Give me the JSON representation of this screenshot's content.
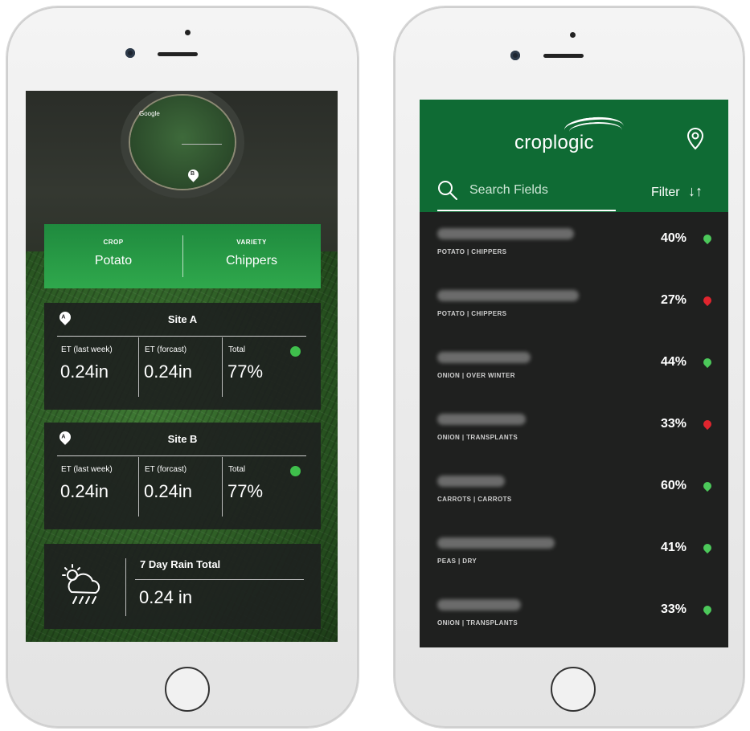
{
  "left_screen": {
    "map": {
      "google_label": "Google",
      "pin_label": "B"
    },
    "crop": {
      "crop_header": "CROP",
      "crop_value": "Potato",
      "variety_header": "VARIETY",
      "variety_value": "Chippers"
    },
    "sites": [
      {
        "pin": "A",
        "name": "Site A",
        "metrics": [
          {
            "label": "ET (last week)",
            "value": "0.24in"
          },
          {
            "label": "ET (forcast)",
            "value": "0.24in"
          },
          {
            "label": "Total",
            "value": "77%"
          }
        ],
        "status_color": "#3fbf4c"
      },
      {
        "pin": "A",
        "name": "Site B",
        "metrics": [
          {
            "label": "ET (last week)",
            "value": "0.24in"
          },
          {
            "label": "ET (forcast)",
            "value": "0.24in"
          },
          {
            "label": "Total",
            "value": "77%"
          }
        ],
        "status_color": "#3fbf4c"
      }
    ],
    "rain": {
      "title": "7 Day Rain Total",
      "value": "0.24 in",
      "icon": "cloud-rain-sun-icon"
    }
  },
  "right_screen": {
    "brand": "croplogic",
    "search": {
      "placeholder": "Search Fields"
    },
    "filter_label": "Filter",
    "colors": {
      "header": "#0f6b34",
      "good": "#4cc85a",
      "bad": "#e0252e"
    },
    "fields": [
      {
        "meta": "POTATO | CHIPPERS",
        "percent": "40%",
        "status": "good"
      },
      {
        "meta": "POTATO | CHIPPERS",
        "percent": "27%",
        "status": "bad"
      },
      {
        "meta": "ONION | OVER WINTER",
        "percent": "44%",
        "status": "good"
      },
      {
        "meta": "ONION | TRANSPLANTS",
        "percent": "33%",
        "status": "bad"
      },
      {
        "meta": "CARROTS | CARROTS",
        "percent": "60%",
        "status": "good"
      },
      {
        "meta": "PEAS | DRY",
        "percent": "41%",
        "status": "good"
      },
      {
        "meta": "ONION | TRANSPLANTS",
        "percent": "33%",
        "status": "good"
      }
    ]
  }
}
